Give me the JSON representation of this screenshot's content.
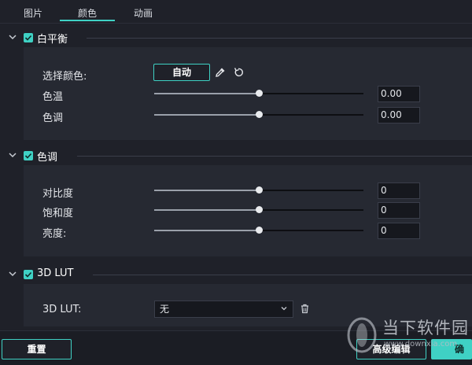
{
  "colors": {
    "accent": "#3fd1c4",
    "background": "#1f2129",
    "panel": "#262932"
  },
  "tabs": [
    {
      "label": "图片",
      "active": false
    },
    {
      "label": "颜色",
      "active": true
    },
    {
      "label": "动画",
      "active": false
    }
  ],
  "white_balance": {
    "title": "白平衡",
    "checked": true,
    "select_color_label": "选择颜色:",
    "auto_label": "自动",
    "eyedropper_icon": "eyedropper-icon",
    "reset_icon": "reset-icon",
    "temperature": {
      "label": "色温",
      "value": "0.00",
      "slider_fraction": 0.5
    },
    "tint": {
      "label": "色调",
      "value": "0.00",
      "slider_fraction": 0.5
    }
  },
  "tone": {
    "title": "色调",
    "checked": true,
    "contrast": {
      "label": "对比度",
      "value": "0",
      "slider_fraction": 0.5
    },
    "saturation": {
      "label": "饱和度",
      "value": "0",
      "slider_fraction": 0.5
    },
    "brightness": {
      "label": "亮度:",
      "value": "0",
      "slider_fraction": 0.5
    }
  },
  "lut": {
    "title": "3D LUT",
    "checked": true,
    "field_label": "3D LUT:",
    "selected": "无",
    "delete_icon": "trash-icon"
  },
  "footer": {
    "reset_label": "重置",
    "advanced_label": "高级编辑",
    "ok_label": "确认"
  },
  "watermark": {
    "text": "当下软件园",
    "url": "www.downxia.com"
  }
}
